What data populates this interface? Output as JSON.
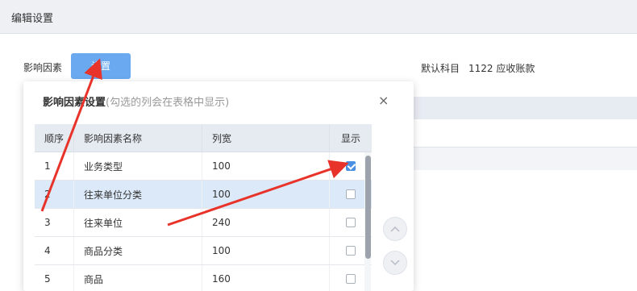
{
  "page": {
    "title": "编辑设置"
  },
  "filters": {
    "factor_label": "影响因素",
    "settings_button": "设置",
    "default_subject_label": "默认科目",
    "default_subject_value": "1122 应收账款"
  },
  "dialog": {
    "title": "影响因素设置",
    "hint": "(勾选的列会在表格中显示)",
    "close_icon": "×",
    "columns": [
      "顺序",
      "影响因素名称",
      "列宽",
      "显示"
    ],
    "rows": [
      {
        "seq": "1",
        "name": "业务类型",
        "width": "100",
        "show": true
      },
      {
        "seq": "2",
        "name": "往来单位分类",
        "width": "100",
        "show": false
      },
      {
        "seq": "3",
        "name": "往来单位",
        "width": "240",
        "show": false
      },
      {
        "seq": "4",
        "name": "商品分类",
        "width": "100",
        "show": false
      },
      {
        "seq": "5",
        "name": "商品",
        "width": "160",
        "show": false
      }
    ],
    "selected_row": 1,
    "move_up_icon": "chevron-up-icon",
    "move_down_icon": "chevron-down-icon"
  },
  "colors": {
    "accent": "#6aa9f0",
    "arrow": "#e8332a",
    "header_bg": "#eef0f4"
  }
}
